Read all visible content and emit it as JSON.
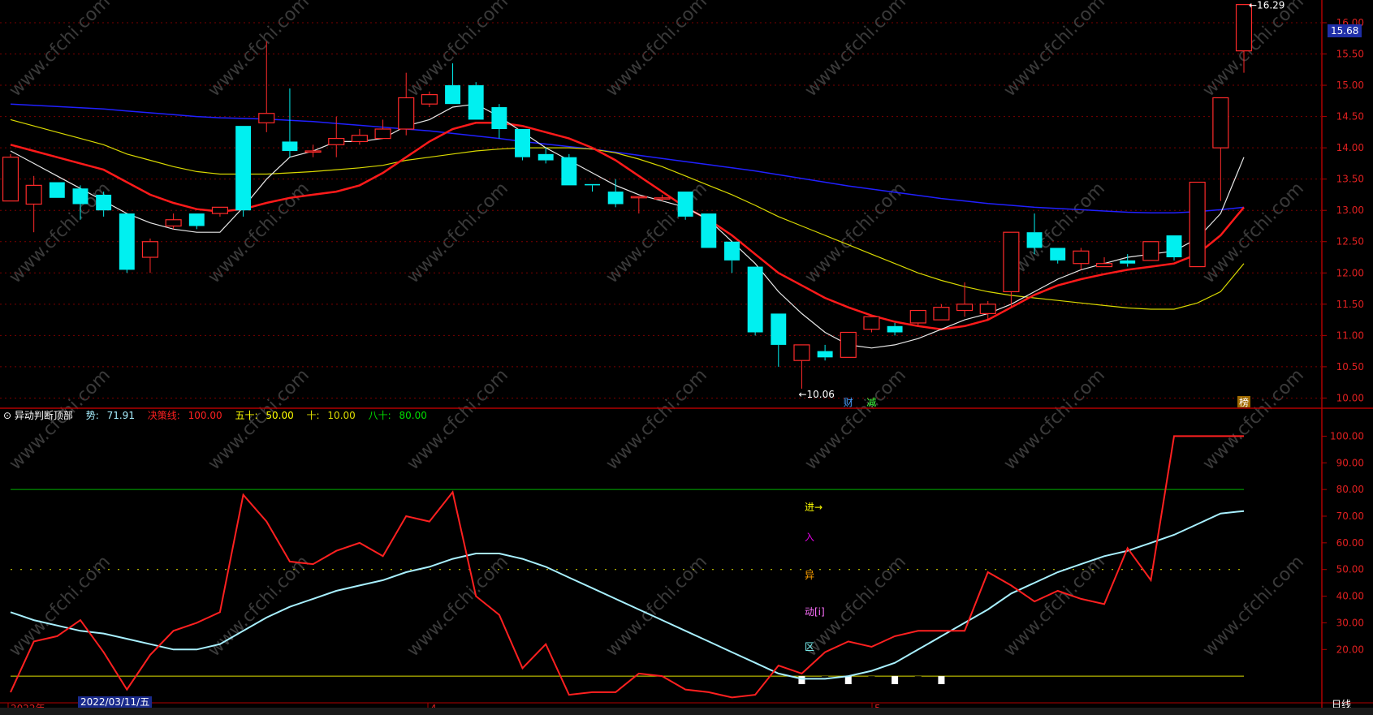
{
  "chart_data": [
    {
      "type": "candlestick",
      "title": "",
      "price_axis": {
        "ylim": [
          9.85,
          16.35
        ],
        "ticks": [
          16.0,
          15.5,
          15.0,
          14.5,
          14.0,
          13.5,
          13.0,
          12.5,
          12.0,
          11.5,
          11.0,
          10.5,
          10.0
        ]
      },
      "current_price_label": "15.68",
      "high_annotation": "16.29",
      "low_annotation": "10.06",
      "candles": [
        [
          13.15,
          13.85,
          13.4,
          13.9
        ],
        [
          13.1,
          13.4,
          12.65,
          13.55
        ],
        [
          13.45,
          13.2,
          13.2,
          13.45
        ],
        [
          13.35,
          13.1,
          12.85,
          13.4
        ],
        [
          13.25,
          13.0,
          12.9,
          13.3
        ],
        [
          12.95,
          12.05,
          12.0,
          12.95
        ],
        [
          12.25,
          12.5,
          12.0,
          12.55
        ],
        [
          12.75,
          12.85,
          12.7,
          12.95
        ],
        [
          12.95,
          12.75,
          12.7,
          12.95
        ],
        [
          12.95,
          13.05,
          12.9,
          13.05
        ],
        [
          14.35,
          13.0,
          12.9,
          14.35
        ],
        [
          14.4,
          14.55,
          14.25,
          15.7
        ],
        [
          14.1,
          13.95,
          13.85,
          14.95
        ],
        [
          13.95,
          13.95,
          13.85,
          14.05
        ],
        [
          14.05,
          14.15,
          13.85,
          14.5
        ],
        [
          14.1,
          14.2,
          14.05,
          14.3
        ],
        [
          14.15,
          14.3,
          14.15,
          14.45
        ],
        [
          14.3,
          14.8,
          14.2,
          15.2
        ],
        [
          14.7,
          14.85,
          14.65,
          14.9
        ],
        [
          15.0,
          14.7,
          14.7,
          15.35
        ],
        [
          15.0,
          14.45,
          14.45,
          15.05
        ],
        [
          14.65,
          14.3,
          14.15,
          14.7
        ],
        [
          14.3,
          13.85,
          13.8,
          14.3
        ],
        [
          13.9,
          13.8,
          13.75,
          14.0
        ],
        [
          13.85,
          13.4,
          13.4,
          13.9
        ],
        [
          13.42,
          13.4,
          13.3,
          13.42
        ],
        [
          13.3,
          13.1,
          13.05,
          13.5
        ],
        [
          13.22,
          13.22,
          12.95,
          13.22
        ],
        [
          13.2,
          13.2,
          13.15,
          13.25
        ],
        [
          13.3,
          12.9,
          12.85,
          13.3
        ],
        [
          12.95,
          12.4,
          12.4,
          12.95
        ],
        [
          12.5,
          12.2,
          12.0,
          12.5
        ],
        [
          12.1,
          11.05,
          11.0,
          12.1
        ],
        [
          11.35,
          10.85,
          10.5,
          11.35
        ],
        [
          10.6,
          10.85,
          10.15,
          10.85
        ],
        [
          10.75,
          10.65,
          10.6,
          10.85
        ],
        [
          10.65,
          11.05,
          10.65,
          11.05
        ],
        [
          11.1,
          11.3,
          11.05,
          11.3
        ],
        [
          11.15,
          11.05,
          11.0,
          11.2
        ],
        [
          11.2,
          11.4,
          11.15,
          11.4
        ],
        [
          11.25,
          11.45,
          11.25,
          11.5
        ],
        [
          11.4,
          11.5,
          11.3,
          11.85
        ],
        [
          11.35,
          11.5,
          11.25,
          11.55
        ],
        [
          11.7,
          12.65,
          11.45,
          12.65
        ],
        [
          12.65,
          12.4,
          12.3,
          12.95
        ],
        [
          12.4,
          12.2,
          12.15,
          12.4
        ],
        [
          12.15,
          12.35,
          12.05,
          12.4
        ],
        [
          12.1,
          12.15,
          12.1,
          12.25
        ],
        [
          12.2,
          12.15,
          12.1,
          12.3
        ],
        [
          12.2,
          12.5,
          12.2,
          12.5
        ],
        [
          12.6,
          12.25,
          12.2,
          12.6
        ],
        [
          12.1,
          13.45,
          12.1,
          13.45
        ],
        [
          14.0,
          14.8,
          13.15,
          14.8
        ],
        [
          15.55,
          16.29,
          15.2,
          16.29
        ]
      ],
      "ma_short": [
        13.95,
        13.75,
        13.55,
        13.35,
        13.15,
        12.95,
        12.8,
        12.7,
        12.65,
        12.65,
        13.05,
        13.5,
        13.85,
        13.95,
        14.1,
        14.1,
        14.15,
        14.35,
        14.45,
        14.65,
        14.7,
        14.5,
        14.25,
        14.0,
        13.8,
        13.6,
        13.4,
        13.25,
        13.15,
        13.05,
        12.85,
        12.5,
        12.15,
        11.7,
        11.35,
        11.05,
        10.85,
        10.8,
        10.85,
        10.95,
        11.1,
        11.25,
        11.35,
        11.5,
        11.7,
        11.9,
        12.05,
        12.15,
        12.25,
        12.3,
        12.35,
        12.55,
        12.95,
        13.85
      ],
      "ma_red": [
        14.05,
        13.95,
        13.85,
        13.75,
        13.65,
        13.45,
        13.25,
        13.12,
        13.02,
        12.98,
        13.02,
        13.12,
        13.2,
        13.25,
        13.3,
        13.4,
        13.6,
        13.85,
        14.1,
        14.3,
        14.4,
        14.4,
        14.35,
        14.25,
        14.15,
        14.0,
        13.8,
        13.55,
        13.3,
        13.05,
        12.85,
        12.6,
        12.3,
        12.0,
        11.8,
        11.6,
        11.45,
        11.32,
        11.22,
        11.15,
        11.1,
        11.15,
        11.25,
        11.45,
        11.65,
        11.8,
        11.9,
        11.98,
        12.05,
        12.1,
        12.15,
        12.3,
        12.6,
        13.05
      ],
      "ma_yellow": [
        14.45,
        14.35,
        14.25,
        14.15,
        14.05,
        13.9,
        13.8,
        13.7,
        13.62,
        13.58,
        13.58,
        13.58,
        13.6,
        13.62,
        13.65,
        13.68,
        13.72,
        13.8,
        13.85,
        13.9,
        13.95,
        13.98,
        14.0,
        14.0,
        14.0,
        13.98,
        13.92,
        13.82,
        13.7,
        13.55,
        13.4,
        13.25,
        13.08,
        12.9,
        12.75,
        12.6,
        12.45,
        12.3,
        12.15,
        12.0,
        11.88,
        11.78,
        11.7,
        11.64,
        11.6,
        11.56,
        11.52,
        11.48,
        11.44,
        11.42,
        11.42,
        11.52,
        11.7,
        12.15
      ],
      "ma_blue": [
        14.7,
        14.68,
        14.66,
        14.64,
        14.62,
        14.59,
        14.56,
        14.53,
        14.5,
        14.48,
        14.47,
        14.46,
        14.44,
        14.42,
        14.39,
        14.36,
        14.33,
        14.3,
        14.27,
        14.23,
        14.19,
        14.15,
        14.1,
        14.06,
        14.02,
        13.98,
        13.93,
        13.88,
        13.83,
        13.78,
        13.73,
        13.68,
        13.63,
        13.57,
        13.51,
        13.45,
        13.39,
        13.34,
        13.29,
        13.24,
        13.19,
        13.15,
        13.11,
        13.08,
        13.05,
        13.03,
        13.01,
        12.99,
        12.97,
        12.96,
        12.96,
        12.98,
        13.01,
        13.05
      ],
      "markers": [
        "财",
        "减",
        "榜"
      ]
    },
    {
      "type": "line",
      "title": "异动判断顶部",
      "ylim": [
        0,
        105
      ],
      "ticks": [
        "100.00",
        "90.00",
        "80.00",
        "70.00",
        "60.00",
        "50.00",
        "40.00",
        "30.00",
        "20.00"
      ],
      "series": [
        {
          "name": "势",
          "color": "#a8f0ff",
          "values": [
            34,
            31,
            29,
            27,
            26,
            24,
            22,
            20,
            20,
            22,
            27,
            32,
            36,
            39,
            42,
            44,
            46,
            49,
            51,
            54,
            56,
            56,
            54,
            51,
            47,
            43,
            39,
            35,
            31,
            27,
            23,
            19,
            15,
            11,
            9,
            9,
            10,
            12,
            15,
            20,
            25,
            30,
            35,
            41,
            45,
            49,
            52,
            55,
            57,
            60,
            63,
            67,
            71,
            71.91
          ]
        },
        {
          "name": "决策线",
          "color": "#ff2020",
          "values": [
            4,
            23,
            25,
            31,
            19,
            5,
            18,
            27,
            30,
            34,
            78,
            68,
            53,
            52,
            57,
            60,
            55,
            70,
            68,
            79,
            40,
            33,
            13,
            22,
            3,
            4,
            4,
            11,
            10,
            5,
            4,
            2,
            3,
            14,
            11,
            19,
            23,
            21,
            25,
            27,
            27,
            27,
            49,
            44,
            38,
            42,
            39,
            37,
            58,
            46,
            100,
            100,
            100,
            100
          ]
        }
      ],
      "hlines": [
        {
          "name": "决策线",
          "value": 100.0,
          "color": "#ff2020"
        },
        {
          "name": "五十",
          "value": 50.0,
          "color": "#ffff00"
        },
        {
          "name": "十",
          "value": 10.0,
          "color": "#cccc00"
        },
        {
          "name": "八十",
          "value": 80.0,
          "color": "#00cc00"
        }
      ],
      "signal_text": [
        "进→",
        "入",
        "异",
        "动[i]",
        "区"
      ]
    }
  ],
  "indicator_header": {
    "name": "异动判断顶部",
    "items": [
      {
        "label": "势:",
        "value": "71.91",
        "color": "#a8f0ff"
      },
      {
        "label": "决策线:",
        "value": "100.00",
        "color": "#ff2020"
      },
      {
        "label": "五十:",
        "value": "50.00",
        "color": "#ffff00"
      },
      {
        "label": "十:",
        "value": "10.00",
        "color": "#dddd00"
      },
      {
        "label": "八十:",
        "value": "80.00",
        "color": "#00dd00"
      }
    ]
  },
  "time_axis": {
    "labels": [
      "2022年",
      "4",
      "5"
    ],
    "cursor_date": "2022/03/11/五",
    "period": "日线"
  },
  "watermark": "www.cfchi.com"
}
